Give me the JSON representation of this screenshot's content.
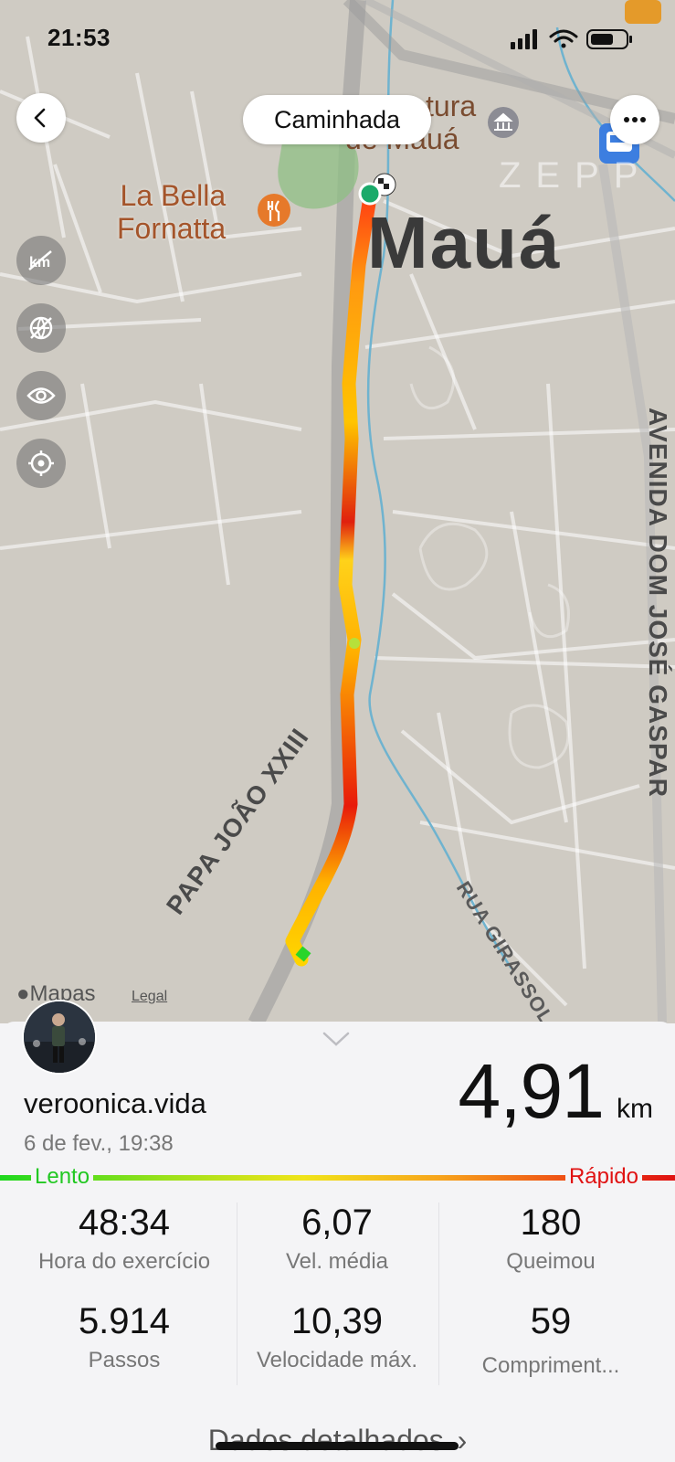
{
  "status": {
    "time": "21:53"
  },
  "header": {
    "title": "Caminhada"
  },
  "map": {
    "labels": {
      "prefeitura_line1": "tura",
      "prefeitura_line2": "de Mauá",
      "restaurant_line1": "La Bella",
      "restaurant_line2": "Fornatta",
      "city": "Mauá",
      "watermark": "ZEPP",
      "avenue": "AVENIDA DOM JOSÉ GASPAR",
      "street_papa": "PAPA JOÃO XXIII",
      "street_girassol": "RUA GIRASSOL"
    },
    "attribution": "Mapas",
    "legal": "Legal"
  },
  "activity": {
    "username": "veroonica.vida",
    "date": "6 de fev., 19:38",
    "distance": "4,91",
    "distance_unit": "km",
    "pace_slow": "Lento",
    "pace_fast": "Rápido",
    "stats": [
      {
        "value": "48:34",
        "label": "Hora do exercício"
      },
      {
        "value": "6,07",
        "label": "Vel. média"
      },
      {
        "value": "180",
        "label": "Queimou"
      },
      {
        "value": "5.914",
        "label": "Passos"
      },
      {
        "value": "10,39",
        "label": "Velocidade máx."
      },
      {
        "value": "59",
        "label": "Compriment..."
      }
    ],
    "details_link": "Dados detalhados"
  },
  "colors": {
    "slow": "#22d822",
    "fast": "#e01212",
    "route_mid": "#ffc400"
  }
}
